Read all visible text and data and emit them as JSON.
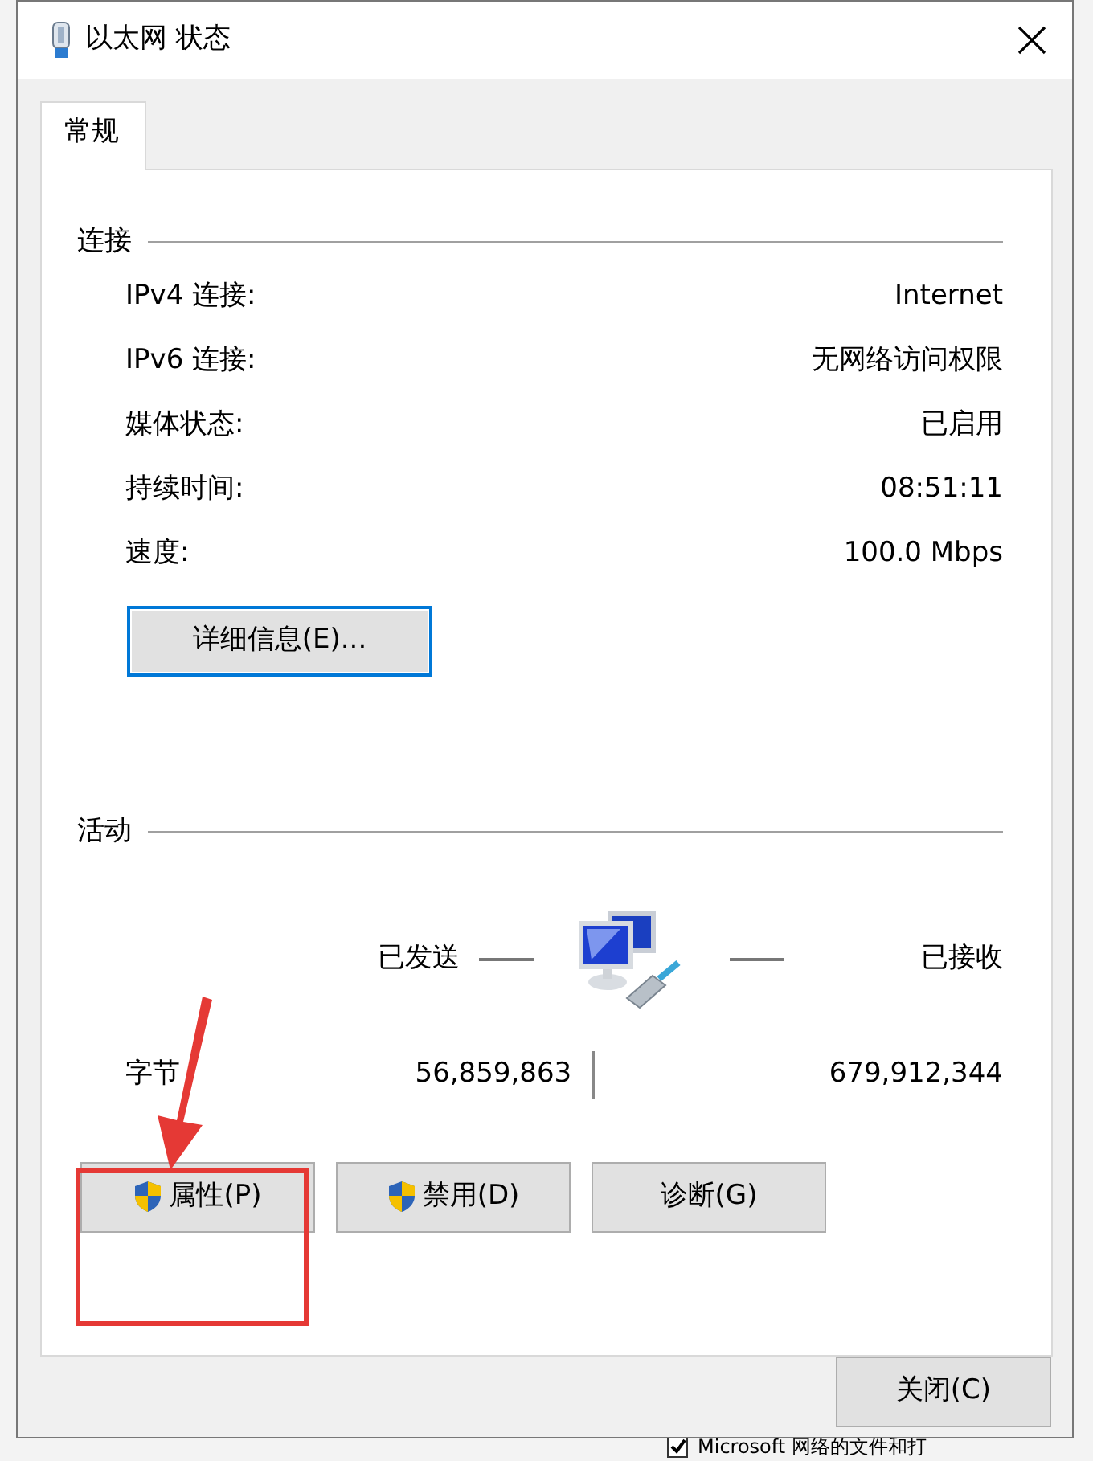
{
  "window": {
    "title": "以太网 状态"
  },
  "tabs": [
    {
      "label": "常规",
      "selected": true
    }
  ],
  "connection": {
    "heading": "连接",
    "rows": [
      {
        "label": "IPv4 连接:",
        "value": "Internet"
      },
      {
        "label": "IPv6 连接:",
        "value": "无网络访问权限"
      },
      {
        "label": "媒体状态:",
        "value": "已启用"
      },
      {
        "label": "持续时间:",
        "value": "08:51:11"
      },
      {
        "label": "速度:",
        "value": "100.0 Mbps"
      }
    ],
    "details_button": "详细信息(E)..."
  },
  "activity": {
    "heading": "活动",
    "sent_label": "已发送",
    "received_label": "已接收",
    "bytes_label": "字节",
    "bytes_sent": "56,859,863",
    "bytes_received": "679,912,344"
  },
  "buttons": [
    {
      "label": "属性(P)",
      "shield": true
    },
    {
      "label": "禁用(D)",
      "shield": true
    },
    {
      "label": "诊断(G)",
      "shield": false
    }
  ],
  "close_button": "关闭(C)",
  "background_window": {
    "item": {
      "checked": true,
      "label": "Microsoft 网络的文件和打"
    }
  }
}
